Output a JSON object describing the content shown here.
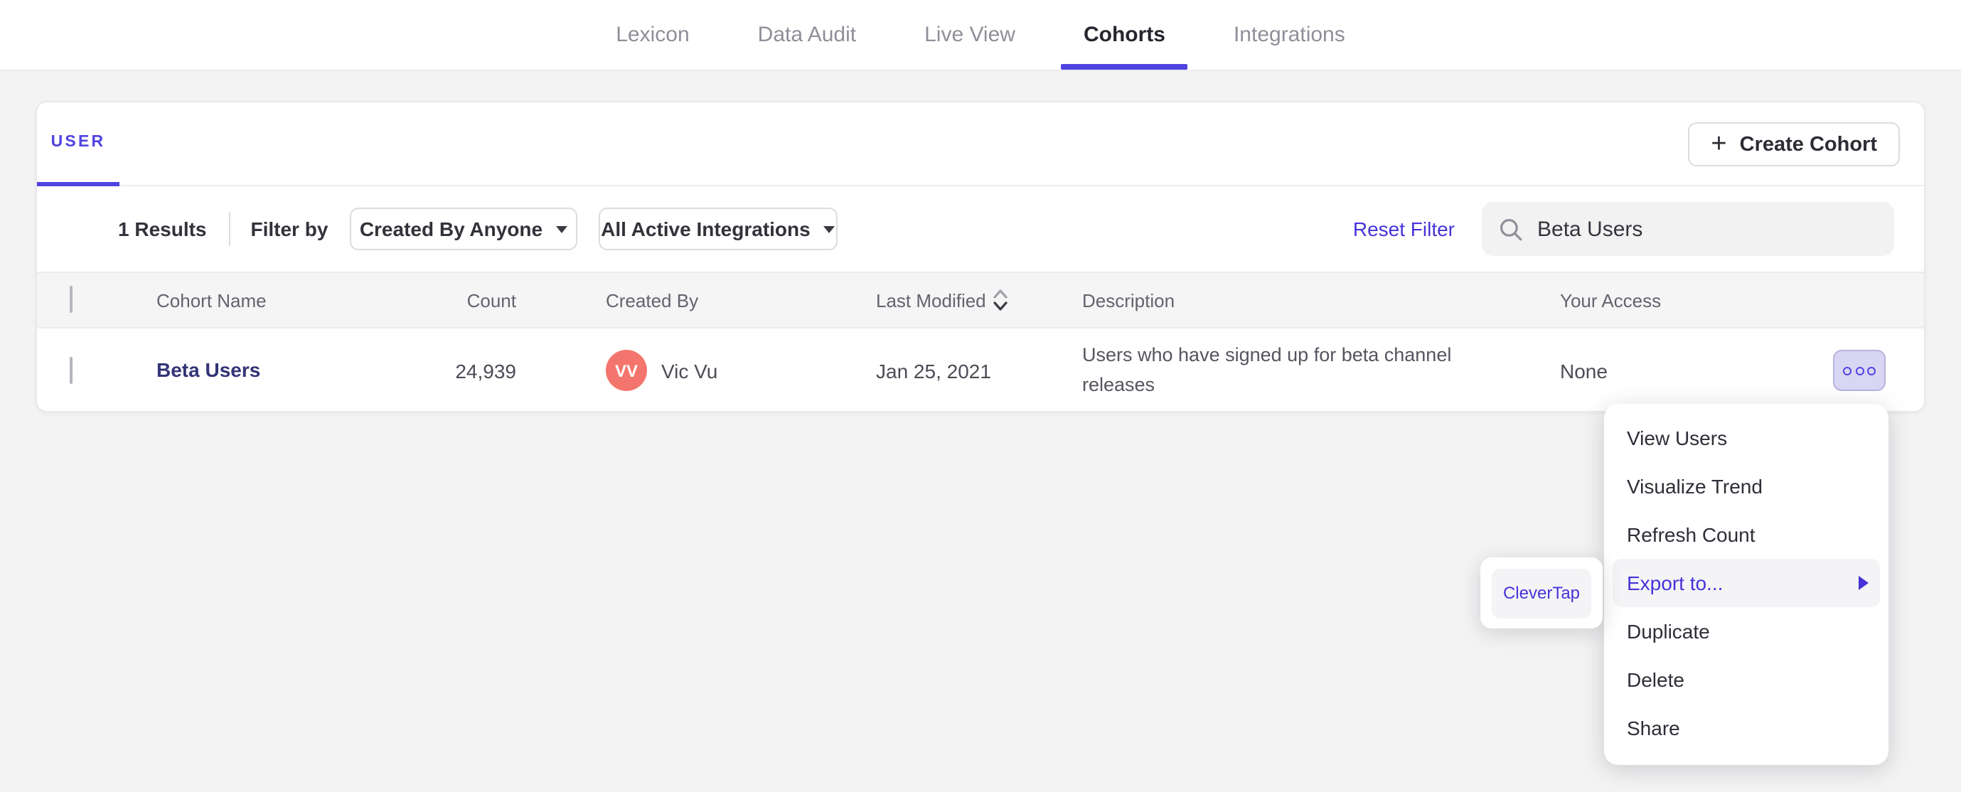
{
  "nav": {
    "tabs": [
      {
        "label": "Lexicon"
      },
      {
        "label": "Data Audit"
      },
      {
        "label": "Live View"
      },
      {
        "label": "Cohorts"
      },
      {
        "label": "Integrations"
      }
    ],
    "active_tab": "Cohorts"
  },
  "card": {
    "tab_label": "USER",
    "create_button": {
      "label": "Create Cohort",
      "icon": "plus"
    },
    "filters": {
      "results_count": "1 Results",
      "filter_by_label": "Filter by",
      "created_by_dropdown": "Created By Anyone",
      "integrations_dropdown": "All Active Integrations",
      "reset_filter": "Reset Filter",
      "search_value": "Beta Users",
      "search_icon": "search-icon"
    },
    "table": {
      "headers": {
        "cohort_name": "Cohort Name",
        "count": "Count",
        "created_by": "Created By",
        "last_modified": "Last Modified",
        "description": "Description",
        "your_access": "Your Access"
      },
      "rows": [
        {
          "name": "Beta Users",
          "count": "24,939",
          "avatar_initials": "VV",
          "created_by": "Vic Vu",
          "last_modified": "Jan 25, 2021",
          "description": "Users who have signed up for beta channel releases",
          "access": "None"
        }
      ]
    }
  },
  "context_menu": {
    "items": [
      "View Users",
      "Visualize Trend",
      "Refresh Count",
      "Export to...",
      "Duplicate",
      "Delete",
      "Share"
    ],
    "highlighted_item": "Export to..."
  },
  "export_submenu": {
    "items": [
      "CleverTap"
    ]
  },
  "colors": {
    "accent_purple": "#4f44e0",
    "link_purple": "#4733d9",
    "row_link_navy": "#333377",
    "avatar_coral": "#f4756d",
    "page_background": "#f3f3f4",
    "table_header_bg": "#f5f5f6",
    "more_button_bg": "#d9d6f3",
    "search_bg": "#f2f2f3"
  }
}
